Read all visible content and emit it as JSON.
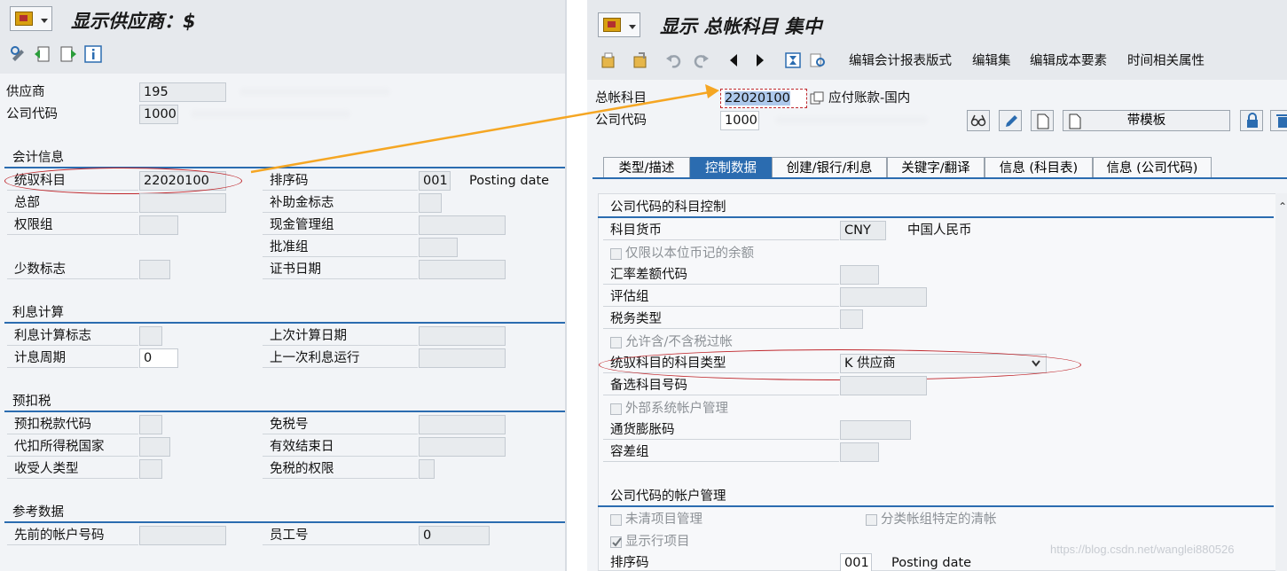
{
  "left": {
    "title": "显示供应商：$",
    "vendor_label": "供应商",
    "vendor_value": "195",
    "company_label": "公司代码",
    "company_value": "1000",
    "sections": {
      "accounting": "会计信息",
      "interest": "利息计算",
      "withholding": "预扣税",
      "reference": "参考数据"
    },
    "fields": {
      "recon_label": "统驭科目",
      "recon_value": "22020100",
      "sort_label": "排序码",
      "sort_value": "001",
      "sort_note": "Posting date",
      "hq_label": "总部",
      "sub_label": "补助金标志",
      "auth_label": "权限组",
      "cash_label": "现金管理组",
      "approve_label": "批准组",
      "minority_label": "少数标志",
      "cert_label": "证书日期",
      "int_ind_label": "利息计算标志",
      "last_calc_label": "上次计算日期",
      "int_cycle_label": "计息周期",
      "int_cycle_value": "0",
      "last_run_label": "上一次利息运行",
      "wht_code_label": "预扣税款代码",
      "exempt_no_label": "免税号",
      "wht_country_label": "代扣所得税国家",
      "valid_end_label": "有效结束日",
      "recipient_label": "收受人类型",
      "exempt_auth_label": "免税的权限",
      "prev_acct_label": "先前的帐户号码",
      "employee_label": "员工号",
      "employee_value": "0"
    }
  },
  "right": {
    "title": "显示 总帐科目 集中",
    "toolbar_links": [
      "编辑会计报表版式",
      "编辑集",
      "编辑成本要素",
      "时间相关属性"
    ],
    "gl_label": "总帐科目",
    "gl_value": "22020100",
    "gl_desc": "应付账款-国内",
    "company_label": "公司代码",
    "company_value": "1000",
    "template_button": "带模板",
    "tabs": [
      "类型/描述",
      "控制数据",
      "创建/银行/利息",
      "关键字/翻译",
      "信息 (科目表)",
      "信息 (公司代码)"
    ],
    "active_tab": "控制数据",
    "section1": "公司代码的科目控制",
    "currency_label": "科目货币",
    "currency_value": "CNY",
    "currency_desc": "中国人民币",
    "local_only_label": "仅限以本位币记的余额",
    "fx_diff_label": "汇率差额代码",
    "valuation_label": "评估组",
    "tax_cat_label": "税务类型",
    "tax_allow_label": "允许含/不含税过帐",
    "recon_type_label": "统驭科目的科目类型",
    "recon_type_value": "K 供应商",
    "alt_acct_label": "备选科目号码",
    "ext_mgmt_label": "外部系统帐户管理",
    "inflation_label": "通货膨胀码",
    "tolerance_label": "容差组",
    "section2": "公司代码的帐户管理",
    "open_item_label": "未清项目管理",
    "split_clear_label": "分类帐组特定的清帐",
    "line_item_label": "显示行项目",
    "sort_label": "排序码",
    "sort_value": "001",
    "sort_note": "Posting date",
    "watermark": "https://blog.csdn.net/wanglei880526"
  },
  "colors": {
    "accent": "#2b6cb0",
    "highlight": "#c0282d",
    "arrow": "#f5a623"
  }
}
